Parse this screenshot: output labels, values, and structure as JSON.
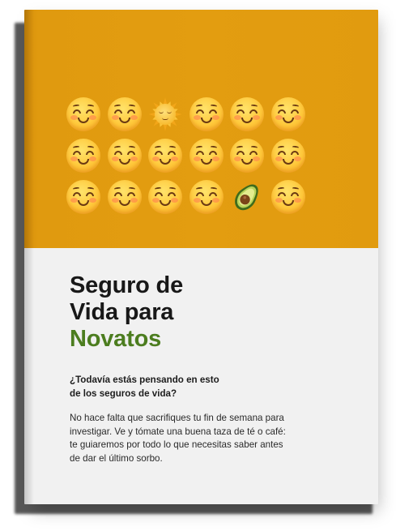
{
  "cover": {
    "top_color": "#e39d10",
    "bottom_color": "#f1f1f1",
    "accent_color": "#4c7d1f",
    "emoji_rows": [
      [
        "smiling-face-icon",
        "smiling-face-icon",
        "sun-with-face-icon",
        "smiling-face-icon",
        "smiling-face-icon",
        "smiling-face-icon"
      ],
      [
        "smiling-face-icon",
        "smiling-face-icon",
        "smiling-face-icon",
        "smiling-face-icon",
        "smiling-face-icon",
        "smiling-face-icon"
      ],
      [
        "smiling-face-icon",
        "smiling-face-icon",
        "smiling-face-icon",
        "smiling-face-icon",
        "avocado-icon",
        "smiling-face-icon"
      ]
    ],
    "title_line1": "Seguro de",
    "title_line2": "Vida para",
    "title_line3": "Novatos",
    "question_line1": "¿Todavía estás pensando en esto",
    "question_line2": "de los seguros de vida?",
    "body_line1": "No hace falta que sacrifiques tu fin de semana para",
    "body_line2": "investigar. Ve y tómate una buena taza de té o café:",
    "body_line3": "te guiaremos por todo lo que necesitas saber antes",
    "body_line4": "de dar el último sorbo."
  }
}
